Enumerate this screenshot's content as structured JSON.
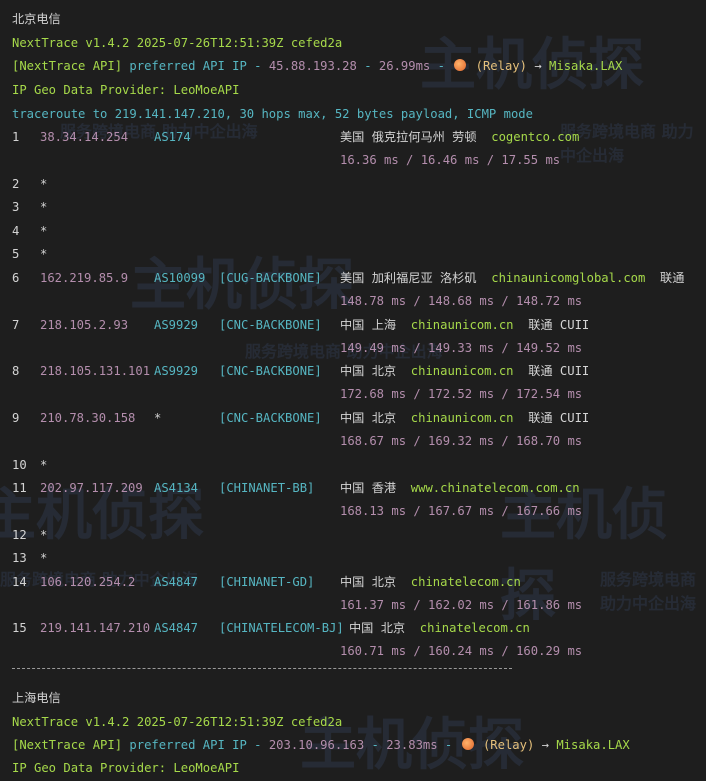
{
  "section1": {
    "title": "北京电信",
    "version_line": "NextTrace v1.4.2 2025-07-26T12:51:39Z cefed2a",
    "api_line": {
      "prefix": "[NextTrace API]",
      "text": " preferred API IP - ",
      "ip": "45.88.193.28",
      "dash": " - ",
      "latency": "26.99ms",
      "mid": " - ",
      "relay": "(Relay)",
      "arrow": " → ",
      "target": "Misaka.LAX"
    },
    "geo_line": "IP Geo Data Provider: LeoMoeAPI",
    "traceroute_line": "traceroute to 219.141.147.210, 30 hops max, 52 bytes payload, ICMP mode",
    "hops": [
      {
        "n": "1",
        "ip": "38.34.14.254",
        "as": "AS174",
        "tag": "",
        "geo": "美国 俄克拉何马州 劳顿",
        "domain": "cogentco.com",
        "isp": "",
        "rtt": "16.36 ms / 16.46 ms / 17.55 ms"
      },
      {
        "n": "2",
        "ip": "*"
      },
      {
        "n": "3",
        "ip": "*"
      },
      {
        "n": "4",
        "ip": "*"
      },
      {
        "n": "5",
        "ip": "*"
      },
      {
        "n": "6",
        "ip": "162.219.85.9",
        "as": "AS10099",
        "tag": "[CUG-BACKBONE]",
        "geo": "美国 加利福尼亚 洛杉矶",
        "domain": "chinaunicomglobal.com",
        "isp": "联通",
        "rtt": "148.78 ms / 148.68 ms / 148.72 ms"
      },
      {
        "n": "7",
        "ip": "218.105.2.93",
        "as": "AS9929",
        "tag": "[CNC-BACKBONE]",
        "geo": "中国 上海",
        "domain": "chinaunicom.cn",
        "isp": "联通 CUII",
        "rtt": "149.49 ms / 149.33 ms / 149.52 ms"
      },
      {
        "n": "8",
        "ip": "218.105.131.101",
        "as": "AS9929",
        "tag": "[CNC-BACKBONE]",
        "geo": "中国 北京",
        "domain": "chinaunicom.cn",
        "isp": "联通 CUII",
        "rtt": "172.68 ms / 172.52 ms / 172.54 ms"
      },
      {
        "n": "9",
        "ip": "210.78.30.158",
        "as": "*",
        "tag": "[CNC-BACKBONE]",
        "geo": "中国 北京",
        "domain": "chinaunicom.cn",
        "isp": "联通 CUII",
        "rtt": "168.67 ms / 169.32 ms / 168.70 ms"
      },
      {
        "n": "10",
        "ip": "*"
      },
      {
        "n": "11",
        "ip": "202.97.117.209",
        "as": "AS4134",
        "tag": "[CHINANET-BB]",
        "geo": "中国 香港",
        "domain": "www.chinatelecom.com.cn",
        "isp": "",
        "rtt": "168.13 ms / 167.67 ms / 167.66 ms"
      },
      {
        "n": "12",
        "ip": "*"
      },
      {
        "n": "13",
        "ip": "*"
      },
      {
        "n": "14",
        "ip": "106.120.254.2",
        "as": "AS4847",
        "tag": "[CHINANET-GD]",
        "geo": "中国 北京",
        "domain": "chinatelecom.cn",
        "isp": "",
        "rtt": "161.37 ms / 162.02 ms / 161.86 ms"
      },
      {
        "n": "15",
        "ip": "219.141.147.210",
        "as": "AS4847",
        "tag": "[CHINATELECOM-BJ]",
        "geo": "中国 北京",
        "domain": "chinatelecom.cn",
        "isp": "",
        "rtt": "160.71 ms / 160.24 ms / 160.29 ms"
      }
    ]
  },
  "section2": {
    "title": "上海电信",
    "version_line": "NextTrace v1.4.2 2025-07-26T12:51:39Z cefed2a",
    "api_line": {
      "prefix": "[NextTrace API]",
      "text": " preferred API IP - ",
      "ip": "203.10.96.163",
      "dash": " - ",
      "latency": "23.83ms",
      "mid": " - ",
      "relay": "(Relay)",
      "arrow": " → ",
      "target": "Misaka.LAX"
    },
    "geo_line": "IP Geo Data Provider: LeoMoeAPI"
  },
  "watermark": {
    "brand": "主机侦探",
    "slogan": "服务跨境电商 助力中企出海"
  },
  "colors": {
    "background": "#1e1e1e",
    "version": "#a6d94a",
    "cyan": "#56b6c2",
    "purple": "#b48ead"
  }
}
